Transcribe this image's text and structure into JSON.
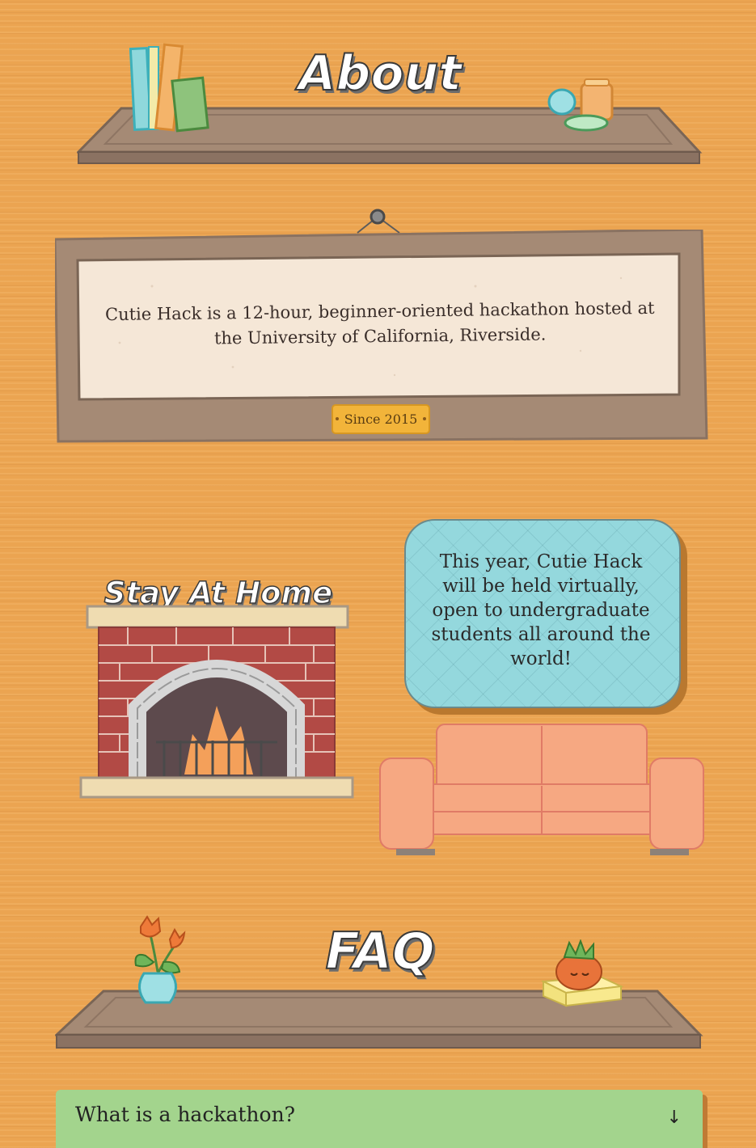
{
  "about": {
    "title": "About",
    "description": "Cutie Hack is a 12-hour, beginner-oriented hackathon hosted at the University of California, Riverside.",
    "badge": "Since 2015"
  },
  "stay_home": {
    "title": "Stay At Home",
    "bubble_text": "This year, Cutie Hack will be held virtually, open to undergraduate students all around the world!"
  },
  "faq": {
    "title": "FAQ",
    "items": [
      {
        "question": "What is a hackathon?",
        "toggle_icon": "arrow-down-icon"
      }
    ]
  },
  "colors": {
    "background": "#eba451",
    "shelf": "#a58a75",
    "bubble": "#94d8dd",
    "faq_item": "#a3d48d",
    "sofa": "#f6a882",
    "brick": "#b24a45"
  }
}
